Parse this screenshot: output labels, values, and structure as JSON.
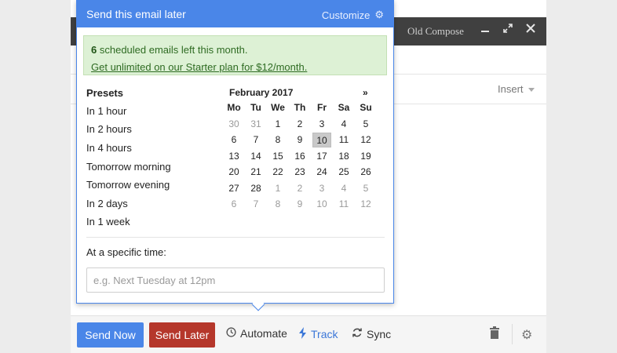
{
  "compose": {
    "old_compose_label": "Old Compose",
    "insert_label": "Insert"
  },
  "toolbar": {
    "send_now_label": "Send Now",
    "send_later_label": "Send Later",
    "automate_label": "Automate",
    "track_label": "Track",
    "sync_label": "Sync"
  },
  "popup": {
    "title": "Send this email later",
    "customize_label": "Customize",
    "notice": {
      "count": "6",
      "text": "scheduled emails left this month.",
      "link": "Get unlimited on our Starter plan for $12/month."
    },
    "presets_heading": "Presets",
    "presets": [
      "In 1 hour",
      "In 2 hours",
      "In 4 hours",
      "Tomorrow morning",
      "Tomorrow evening",
      "In 2 days",
      "In 1 week"
    ],
    "calendar": {
      "month_label": "February 2017",
      "next_label": "»",
      "weekdays": [
        "Mo",
        "Tu",
        "We",
        "Th",
        "Fr",
        "Sa",
        "Su"
      ],
      "weeks": [
        [
          {
            "d": "30",
            "cur": false
          },
          {
            "d": "31",
            "cur": false
          },
          {
            "d": "1",
            "cur": true
          },
          {
            "d": "2",
            "cur": true
          },
          {
            "d": "3",
            "cur": true
          },
          {
            "d": "4",
            "cur": true
          },
          {
            "d": "5",
            "cur": true
          }
        ],
        [
          {
            "d": "6",
            "cur": true
          },
          {
            "d": "7",
            "cur": true
          },
          {
            "d": "8",
            "cur": true
          },
          {
            "d": "9",
            "cur": true
          },
          {
            "d": "10",
            "cur": true,
            "sel": true
          },
          {
            "d": "11",
            "cur": true
          },
          {
            "d": "12",
            "cur": true
          }
        ],
        [
          {
            "d": "13",
            "cur": true
          },
          {
            "d": "14",
            "cur": true
          },
          {
            "d": "15",
            "cur": true
          },
          {
            "d": "16",
            "cur": true
          },
          {
            "d": "17",
            "cur": true
          },
          {
            "d": "18",
            "cur": true
          },
          {
            "d": "19",
            "cur": true
          }
        ],
        [
          {
            "d": "20",
            "cur": true
          },
          {
            "d": "21",
            "cur": true
          },
          {
            "d": "22",
            "cur": true
          },
          {
            "d": "23",
            "cur": true
          },
          {
            "d": "24",
            "cur": true
          },
          {
            "d": "25",
            "cur": true
          },
          {
            "d": "26",
            "cur": true
          }
        ],
        [
          {
            "d": "27",
            "cur": true
          },
          {
            "d": "28",
            "cur": true
          },
          {
            "d": "1",
            "cur": false
          },
          {
            "d": "2",
            "cur": false
          },
          {
            "d": "3",
            "cur": false
          },
          {
            "d": "4",
            "cur": false
          },
          {
            "d": "5",
            "cur": false
          }
        ],
        [
          {
            "d": "6",
            "cur": false
          },
          {
            "d": "7",
            "cur": false
          },
          {
            "d": "8",
            "cur": false
          },
          {
            "d": "9",
            "cur": false
          },
          {
            "d": "10",
            "cur": false
          },
          {
            "d": "11",
            "cur": false
          },
          {
            "d": "12",
            "cur": false
          }
        ]
      ]
    },
    "specific_time_label": "At a specific time:",
    "time_placeholder": "e.g. Next Tuesday at 12pm"
  },
  "colors": {
    "accent": "#4a86e8",
    "send_later": "#b5372b",
    "notice_bg": "#ddf1d5",
    "header_dark": "#404040"
  }
}
